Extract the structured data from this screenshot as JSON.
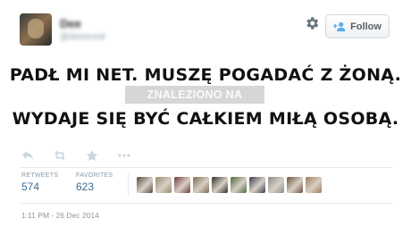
{
  "user": {
    "display_name": "Dee",
    "handle": "@deeisreal"
  },
  "follow_label": "Follow",
  "tweet": {
    "line1": "PADŁ MI NET. MUSZĘ POGADAĆ Z ŻONĄ.",
    "line2": "WYDAJE SIĘ BYĆ CAŁKIEM MIŁĄ OSOBĄ."
  },
  "watermark": "ZNALEZIONO NA JEJA.PL",
  "actions": [
    "reply-icon",
    "retweet-icon",
    "favorite-icon",
    "more-icon"
  ],
  "stats": {
    "retweets_label": "RETWEETS",
    "retweets": "574",
    "favorites_label": "FAVORITES",
    "favorites": "623"
  },
  "favoriters": [
    "#5a4a3e",
    "#9a8a6c",
    "#6e3b3b",
    "#7a6a55",
    "#2d2d2d",
    "#4a6a3a",
    "#3c3c48",
    "#8a8a8a",
    "#6b5240",
    "#a07a5a"
  ],
  "timestamp": "1:11 PM - 26 Dec 2014",
  "colors": {
    "accent": "#3b6c96",
    "muted": "#8899a6",
    "text": "#111111"
  }
}
